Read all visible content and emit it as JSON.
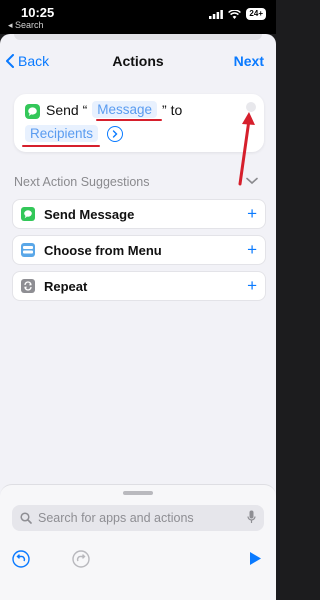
{
  "status_bar": {
    "time": "10:25",
    "back_app": "◂ Search",
    "battery": "24+"
  },
  "nav": {
    "back_label": "Back",
    "title": "Actions",
    "next_label": "Next"
  },
  "action": {
    "verb": "Send “",
    "message_token": "Message",
    "mid_text": "” to",
    "recipients_token": "Recipients"
  },
  "suggestions": {
    "header": "Next Action Suggestions",
    "items": [
      {
        "label": "Send Message",
        "icon": "messages-icon",
        "color": "#33c759"
      },
      {
        "label": "Choose from Menu",
        "icon": "menu-icon",
        "color": "#5aa7e8"
      },
      {
        "label": "Repeat",
        "icon": "repeat-icon",
        "color": "#8e8e93"
      }
    ]
  },
  "search": {
    "placeholder": "Search for apps and actions"
  },
  "colors": {
    "accent": "#0a7aff",
    "annotation": "#d61f2c"
  }
}
